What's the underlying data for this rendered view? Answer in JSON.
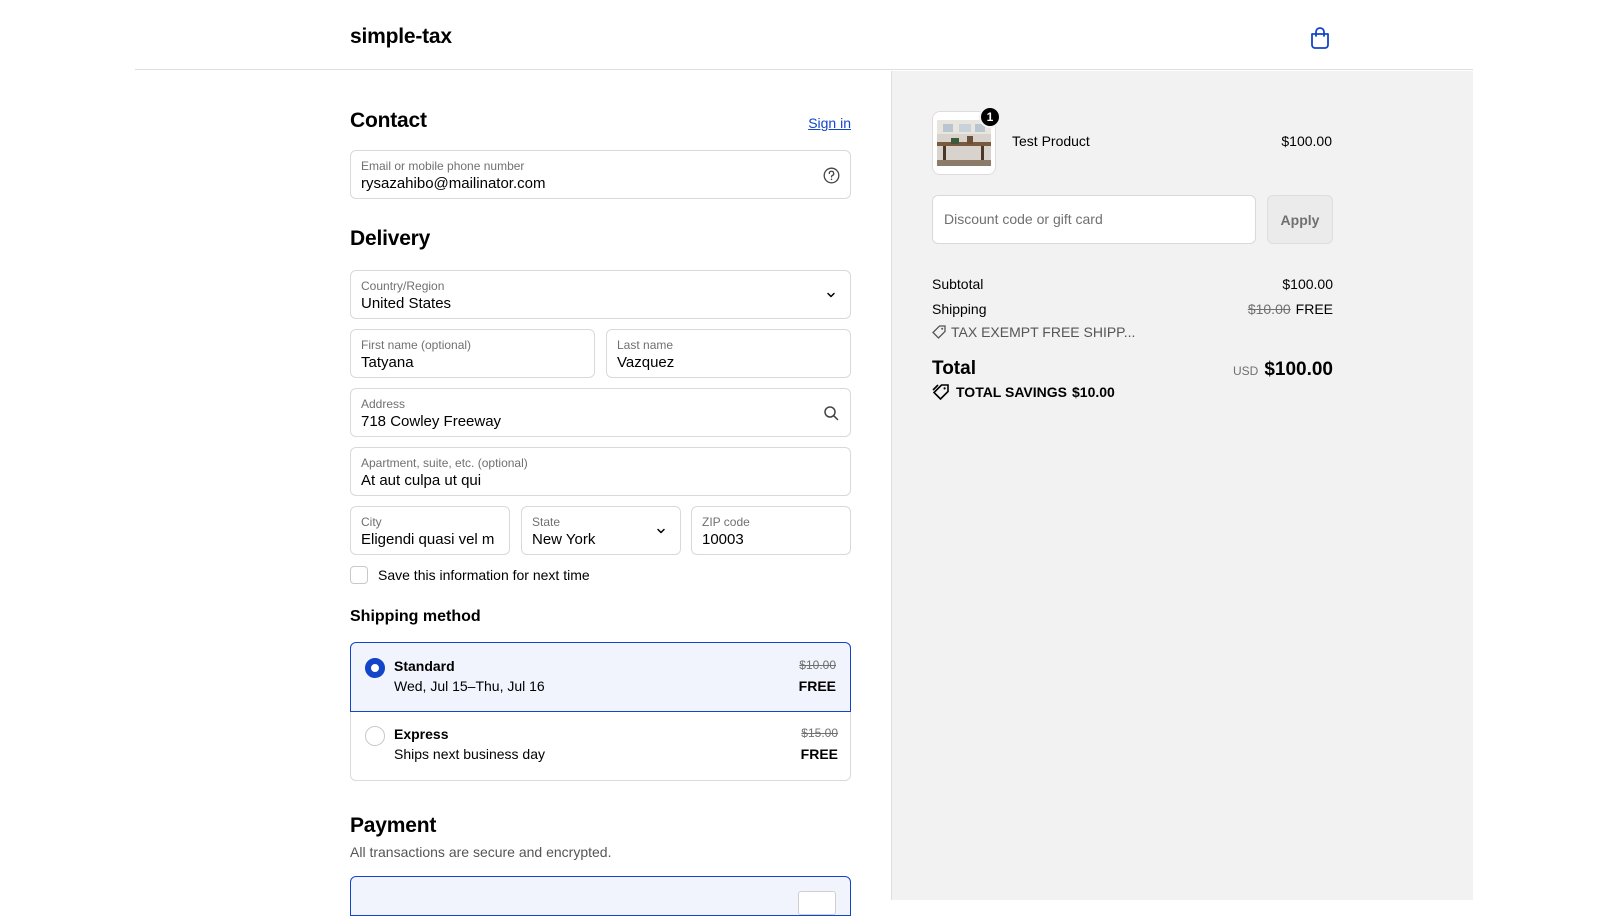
{
  "header": {
    "brand": "simple-tax"
  },
  "contact": {
    "title": "Contact",
    "sign_in": "Sign in",
    "email_label": "Email or mobile phone number",
    "email_value": "rysazahibo@mailinator.com"
  },
  "delivery": {
    "title": "Delivery",
    "country_label": "Country/Region",
    "country_value": "United States",
    "first_name_label": "First name (optional)",
    "first_name_value": "Tatyana",
    "last_name_label": "Last name",
    "last_name_value": "Vazquez",
    "address_label": "Address",
    "address_value": "718 Cowley Freeway",
    "apt_label": "Apartment, suite, etc. (optional)",
    "apt_value": "At aut culpa ut qui",
    "city_label": "City",
    "city_value": "Eligendi quasi vel m",
    "state_label": "State",
    "state_value": "New York",
    "zip_label": "ZIP code",
    "zip_value": "10003",
    "save_info": "Save this information for next time"
  },
  "shipping": {
    "title": "Shipping method",
    "options": [
      {
        "name": "Standard",
        "sub": "Wed, Jul 15–Thu, Jul 16",
        "old": "$10.00",
        "price": "FREE",
        "selected": true
      },
      {
        "name": "Express",
        "sub": "Ships next business day",
        "old": "$15.00",
        "price": "FREE",
        "selected": false
      }
    ]
  },
  "payment": {
    "title": "Payment",
    "subtitle": "All transactions are secure and encrypted."
  },
  "summary": {
    "product_name": "Test Product",
    "product_price": "$100.00",
    "quantity": "1",
    "discount_placeholder": "Discount code or gift card",
    "apply": "Apply",
    "subtotal_label": "Subtotal",
    "subtotal_value": "$100.00",
    "shipping_label": "Shipping",
    "shipping_old": "$10.00",
    "shipping_value": "FREE",
    "discount_tag": "TAX EXEMPT FREE SHIPP...",
    "total_label": "Total",
    "currency": "USD",
    "total_value": "$100.00",
    "savings_label": "TOTAL SAVINGS",
    "savings_value": "$10.00"
  },
  "colors": {
    "accent": "#1245c7",
    "panel_bg": "#f2f2f2",
    "selected_bg": "#f1f4fd"
  }
}
